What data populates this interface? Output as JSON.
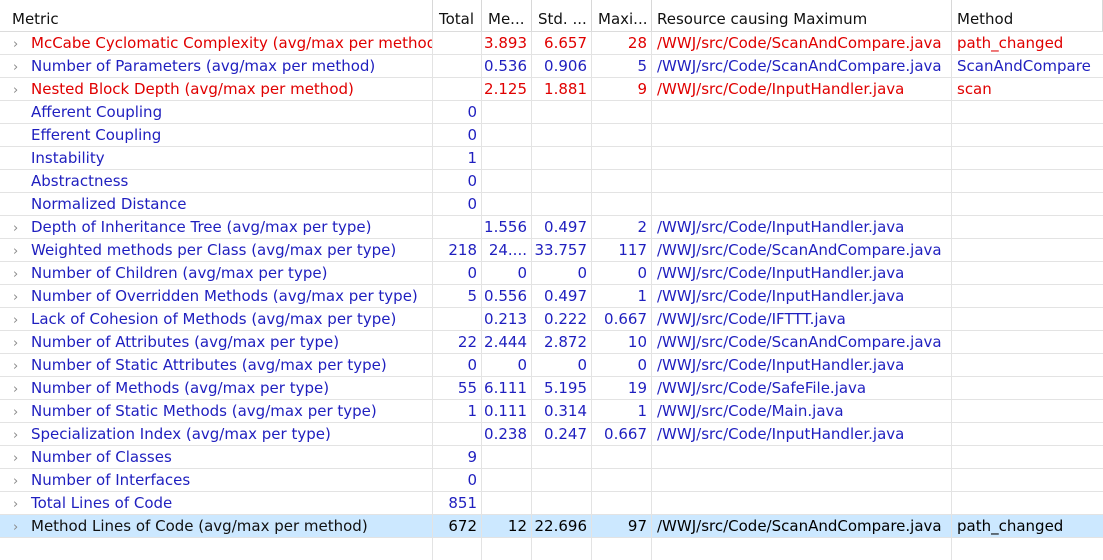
{
  "columns": {
    "metric": "Metric",
    "total": "Total",
    "mean": "Me...",
    "std": "Std. ...",
    "max": "Maxi...",
    "resource": "Resource causing Maximum",
    "method": "Method"
  },
  "rows": [
    {
      "metric": "McCabe Cyclomatic Complexity (avg/max per method)",
      "total": "",
      "mean": "3.893",
      "std": "6.657",
      "max": "28",
      "resource": "/WWJ/src/Code/ScanAndCompare.java",
      "method": "path_changed",
      "expandable": true,
      "color": "red"
    },
    {
      "metric": "Number of Parameters (avg/max per method)",
      "total": "",
      "mean": "0.536",
      "std": "0.906",
      "max": "5",
      "resource": "/WWJ/src/Code/ScanAndCompare.java",
      "method": "ScanAndCompare",
      "expandable": true,
      "color": "blue"
    },
    {
      "metric": "Nested Block Depth (avg/max per method)",
      "total": "",
      "mean": "2.125",
      "std": "1.881",
      "max": "9",
      "resource": "/WWJ/src/Code/InputHandler.java",
      "method": "scan",
      "expandable": true,
      "color": "red"
    },
    {
      "metric": "Afferent Coupling",
      "total": "0",
      "mean": "",
      "std": "",
      "max": "",
      "resource": "",
      "method": "",
      "expandable": false,
      "color": "blue"
    },
    {
      "metric": "Efferent Coupling",
      "total": "0",
      "mean": "",
      "std": "",
      "max": "",
      "resource": "",
      "method": "",
      "expandable": false,
      "color": "blue"
    },
    {
      "metric": "Instability",
      "total": "1",
      "mean": "",
      "std": "",
      "max": "",
      "resource": "",
      "method": "",
      "expandable": false,
      "color": "blue"
    },
    {
      "metric": "Abstractness",
      "total": "0",
      "mean": "",
      "std": "",
      "max": "",
      "resource": "",
      "method": "",
      "expandable": false,
      "color": "blue"
    },
    {
      "metric": "Normalized Distance",
      "total": "0",
      "mean": "",
      "std": "",
      "max": "",
      "resource": "",
      "method": "",
      "expandable": false,
      "color": "blue"
    },
    {
      "metric": "Depth of Inheritance Tree (avg/max per type)",
      "total": "",
      "mean": "1.556",
      "std": "0.497",
      "max": "2",
      "resource": "/WWJ/src/Code/InputHandler.java",
      "method": "",
      "expandable": true,
      "color": "blue"
    },
    {
      "metric": "Weighted methods per Class (avg/max per type)",
      "total": "218",
      "mean": "24....",
      "std": "33.757",
      "max": "117",
      "resource": "/WWJ/src/Code/ScanAndCompare.java",
      "method": "",
      "expandable": true,
      "color": "blue"
    },
    {
      "metric": "Number of Children (avg/max per type)",
      "total": "0",
      "mean": "0",
      "std": "0",
      "max": "0",
      "resource": "/WWJ/src/Code/InputHandler.java",
      "method": "",
      "expandable": true,
      "color": "blue"
    },
    {
      "metric": "Number of Overridden Methods (avg/max per type)",
      "total": "5",
      "mean": "0.556",
      "std": "0.497",
      "max": "1",
      "resource": "/WWJ/src/Code/InputHandler.java",
      "method": "",
      "expandable": true,
      "color": "blue"
    },
    {
      "metric": "Lack of Cohesion of Methods (avg/max per type)",
      "total": "",
      "mean": "0.213",
      "std": "0.222",
      "max": "0.667",
      "resource": "/WWJ/src/Code/IFTTT.java",
      "method": "",
      "expandable": true,
      "color": "blue"
    },
    {
      "metric": "Number of Attributes (avg/max per type)",
      "total": "22",
      "mean": "2.444",
      "std": "2.872",
      "max": "10",
      "resource": "/WWJ/src/Code/ScanAndCompare.java",
      "method": "",
      "expandable": true,
      "color": "blue"
    },
    {
      "metric": "Number of Static Attributes (avg/max per type)",
      "total": "0",
      "mean": "0",
      "std": "0",
      "max": "0",
      "resource": "/WWJ/src/Code/InputHandler.java",
      "method": "",
      "expandable": true,
      "color": "blue"
    },
    {
      "metric": "Number of Methods (avg/max per type)",
      "total": "55",
      "mean": "6.111",
      "std": "5.195",
      "max": "19",
      "resource": "/WWJ/src/Code/SafeFile.java",
      "method": "",
      "expandable": true,
      "color": "blue"
    },
    {
      "metric": "Number of Static Methods (avg/max per type)",
      "total": "1",
      "mean": "0.111",
      "std": "0.314",
      "max": "1",
      "resource": "/WWJ/src/Code/Main.java",
      "method": "",
      "expandable": true,
      "color": "blue"
    },
    {
      "metric": "Specialization Index (avg/max per type)",
      "total": "",
      "mean": "0.238",
      "std": "0.247",
      "max": "0.667",
      "resource": "/WWJ/src/Code/InputHandler.java",
      "method": "",
      "expandable": true,
      "color": "blue"
    },
    {
      "metric": "Number of Classes",
      "total": "9",
      "mean": "",
      "std": "",
      "max": "",
      "resource": "",
      "method": "",
      "expandable": true,
      "color": "blue"
    },
    {
      "metric": "Number of Interfaces",
      "total": "0",
      "mean": "",
      "std": "",
      "max": "",
      "resource": "",
      "method": "",
      "expandable": true,
      "color": "blue"
    },
    {
      "metric": "Total Lines of Code",
      "total": "851",
      "mean": "",
      "std": "",
      "max": "",
      "resource": "",
      "method": "",
      "expandable": true,
      "color": "blue"
    },
    {
      "metric": "Method Lines of Code (avg/max per method)",
      "total": "672",
      "mean": "12",
      "std": "22.696",
      "max": "97",
      "resource": "/WWJ/src/Code/ScanAndCompare.java",
      "method": "path_changed",
      "expandable": true,
      "color": "black",
      "selected": true
    }
  ],
  "icons": {
    "expand": "chevron-right-icon"
  },
  "colors": {
    "violation": "#e00000",
    "normal": "#1f1fbf",
    "selection": "#cce8ff"
  }
}
